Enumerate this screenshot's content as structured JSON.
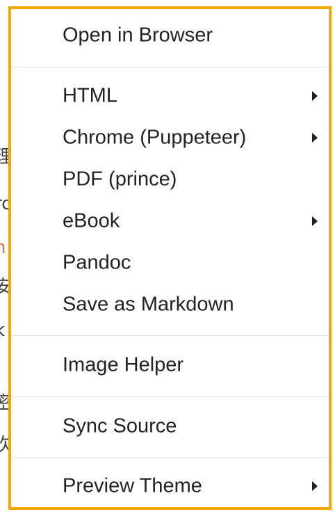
{
  "menu": {
    "accent_color": "#f5a800",
    "items": [
      {
        "label": "Open in Browser",
        "has_submenu": false
      },
      {
        "label": "HTML",
        "has_submenu": true
      },
      {
        "label": "Chrome (Puppeteer)",
        "has_submenu": true
      },
      {
        "label": "PDF (prince)",
        "has_submenu": false
      },
      {
        "label": "eBook",
        "has_submenu": true
      },
      {
        "label": "Pandoc",
        "has_submenu": false
      },
      {
        "label": "Save as Markdown",
        "has_submenu": false
      },
      {
        "label": "Image Helper",
        "has_submenu": false
      },
      {
        "label": "Sync Source",
        "has_submenu": false
      },
      {
        "label": "Preview Theme",
        "has_submenu": true
      }
    ],
    "arrow_icon": "chevron-right-icon"
  },
  "background": {
    "glyphs": [
      "理",
      "rc",
      "n",
      "安",
      "k",
      "密",
      "次"
    ]
  }
}
